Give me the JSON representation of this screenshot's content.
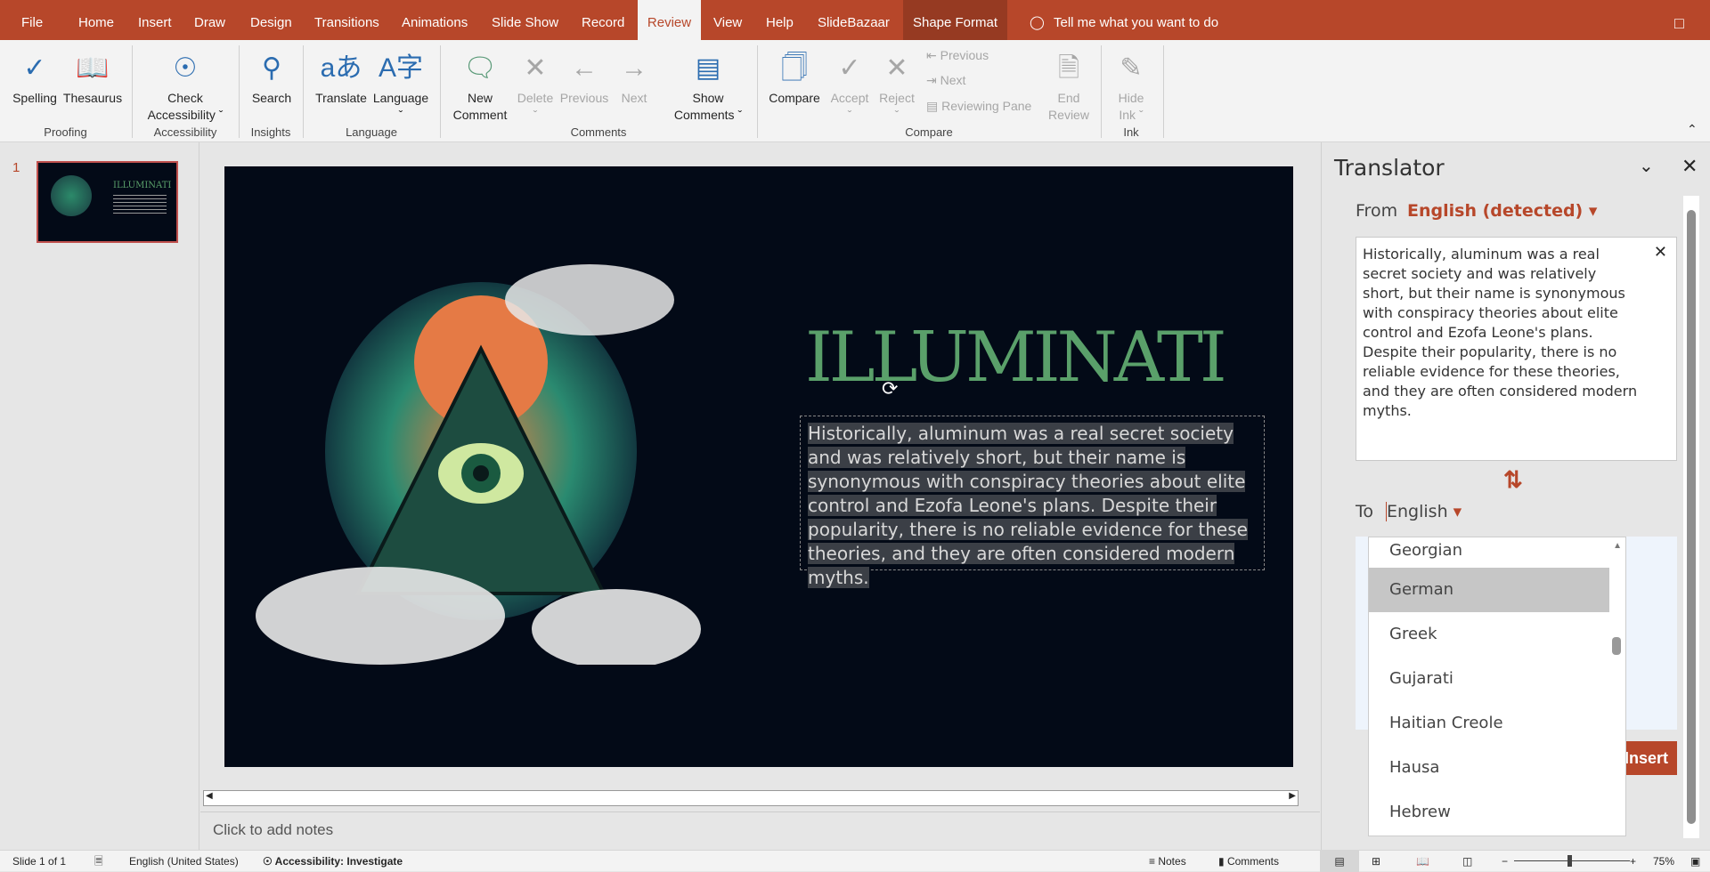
{
  "tabs": [
    "File",
    "Home",
    "Insert",
    "Draw",
    "Design",
    "Transitions",
    "Animations",
    "Slide Show",
    "Record",
    "Review",
    "View",
    "Help",
    "SlideBazaar",
    "Shape Format"
  ],
  "active_tab": "Review",
  "tell_me": "Tell me what you want to do",
  "ribbon": {
    "spelling": "Spelling",
    "thesaurus": "Thesaurus",
    "check": "Check",
    "accessibility": "Accessibility",
    "search": "Search",
    "translate": "Translate",
    "language": "Language",
    "new": "New",
    "comment": "Comment",
    "delete": "Delete",
    "previous": "Previous",
    "next": "Next",
    "show": "Show",
    "comments": "Comments",
    "compare": "Compare",
    "accept": "Accept",
    "reject": "Reject",
    "prev_small": "Previous",
    "next_small": "Next",
    "reviewing_pane": "Reviewing Pane",
    "end": "End",
    "review": "Review",
    "hide": "Hide",
    "ink": "Ink",
    "groups": {
      "proofing": "Proofing",
      "accessibility": "Accessibility",
      "insights": "Insights",
      "language": "Language",
      "comments": "Comments",
      "compare": "Compare",
      "ink": "Ink"
    }
  },
  "thumbnail": {
    "number": "1",
    "title": "ILLUMINATI"
  },
  "slide": {
    "title": "ILLUMINATI",
    "body": "Historically, aluminum was a real secret society and was relatively short, but their name is synonymous with conspiracy theories about elite control and Ezofa Leone's plans. Despite their popularity, there is no reliable evidence for these theories, and they are often considered modern myths."
  },
  "notes_placeholder": "Click to add notes",
  "status": {
    "slide": "Slide 1 of 1",
    "language": "English (United States)",
    "accessibility": "Accessibility: Investigate",
    "notes": "Notes",
    "comments": "Comments",
    "zoom": "75%",
    "zoom_level": 75
  },
  "translator": {
    "title": "Translator",
    "from_label": "From",
    "from_lang": "English (detected)",
    "source_text": "Historically, aluminum was a real secret society and was relatively short, but their name is synonymous with conspiracy theories about elite control and Ezofa Leone's plans. Despite their popularity, there is no reliable evidence for these theories, and they are often considered modern myths.",
    "to_label": "To",
    "to_lang": "English",
    "insert": "Insert",
    "dropdown": [
      "Georgian",
      "German",
      "Greek",
      "Gujarati",
      "Haitian Creole",
      "Hausa",
      "Hebrew"
    ],
    "selected": "German",
    "accent": "#b7472a"
  }
}
